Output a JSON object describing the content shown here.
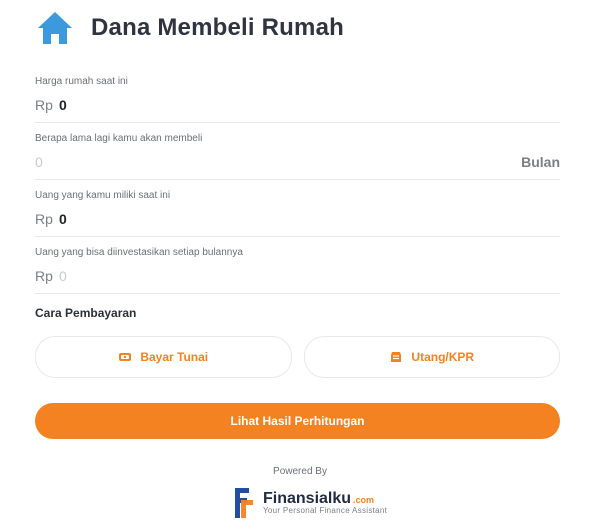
{
  "header": {
    "title": "Dana Membeli Rumah",
    "icon": "house-icon",
    "icon_color": "#3C99DC"
  },
  "fields": [
    {
      "label": "Harga rumah saat ini",
      "prefix": "Rp",
      "value": "0",
      "is_placeholder": false,
      "suffix": ""
    },
    {
      "label": "Berapa lama lagi kamu akan membeli",
      "prefix": "",
      "value": "0",
      "is_placeholder": true,
      "suffix": "Bulan"
    },
    {
      "label": "Uang yang kamu miliki saat ini",
      "prefix": "Rp",
      "value": "0",
      "is_placeholder": false,
      "suffix": ""
    },
    {
      "label": "Uang yang bisa diinvestasikan setiap bulannya",
      "prefix": "Rp",
      "value": "0",
      "is_placeholder": true,
      "suffix": ""
    }
  ],
  "payment": {
    "title": "Cara Pembayaran",
    "options": [
      {
        "label": "Bayar Tunai",
        "icon": "cash-icon"
      },
      {
        "label": "Utang/KPR",
        "icon": "loan-icon"
      }
    ]
  },
  "cta": {
    "label": "Lihat Hasil Perhitungan",
    "color": "#F58220"
  },
  "footer": {
    "powered_by": "Powered By",
    "brand_name": "Finansialku",
    "brand_tld": ".com",
    "brand_tagline": "Your Personal Finance Assistant",
    "brand_logo_icon": "finansialku-logo"
  }
}
